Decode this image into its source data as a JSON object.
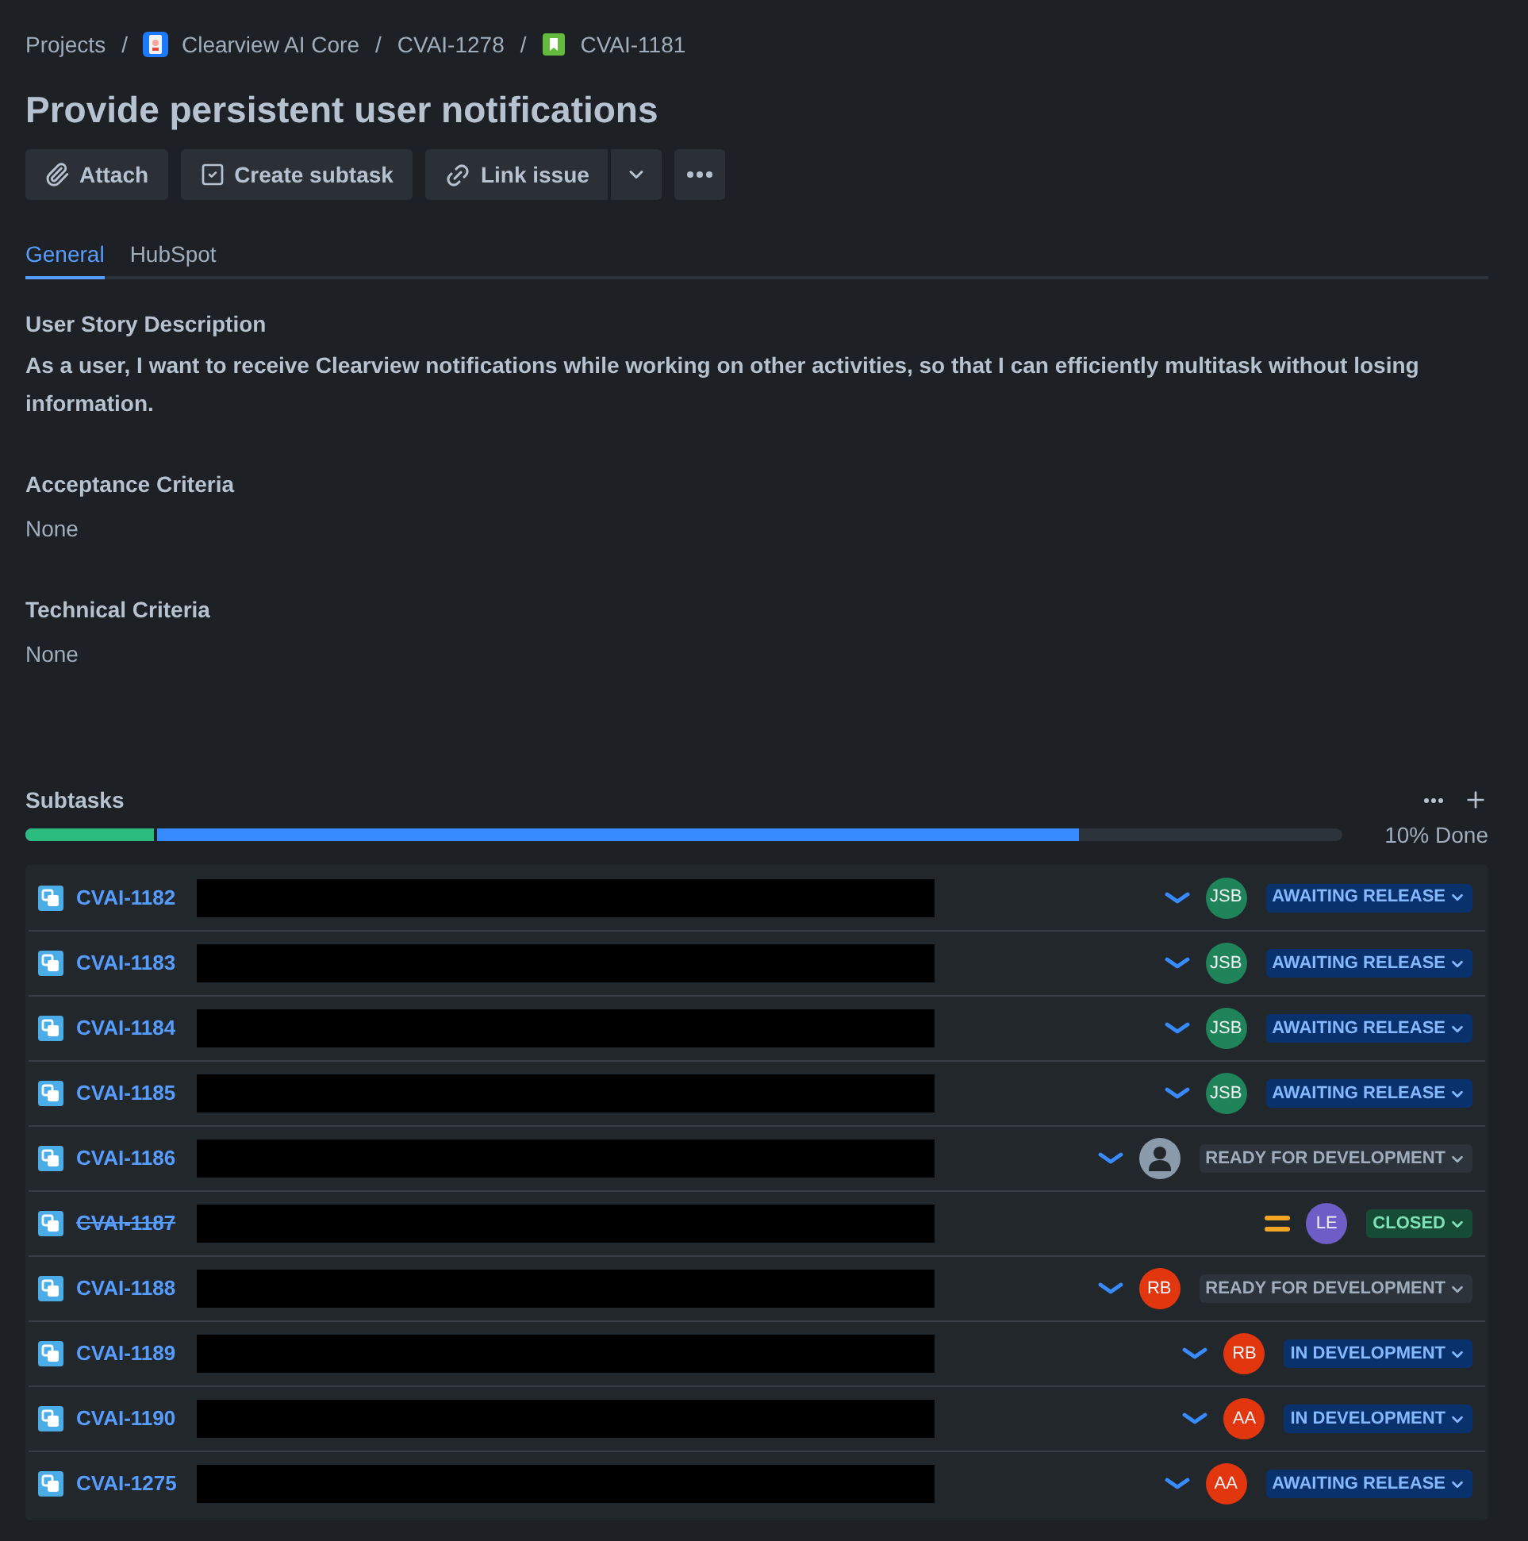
{
  "breadcrumbs": {
    "separator": "/",
    "items": [
      {
        "label": "Projects",
        "kind": "text"
      },
      {
        "label": "Clearview AI Core",
        "kind": "project"
      },
      {
        "label": "CVAI-1278",
        "kind": "text"
      },
      {
        "label": "CVAI-1181",
        "kind": "story"
      }
    ]
  },
  "title": "Provide persistent user notifications",
  "toolbar": [
    {
      "kind": "attach",
      "label": "Attach"
    },
    {
      "kind": "subtask",
      "label": "Create subtask"
    },
    {
      "kind": "link",
      "label": "Link issue"
    },
    {
      "kind": "more"
    }
  ],
  "tabs": [
    {
      "label": "General",
      "selected": true
    },
    {
      "label": "HubSpot",
      "selected": false
    }
  ],
  "sections": [
    {
      "heading": "User Story Description",
      "body": "As a user, I want to receive Clearview notifications while working on other activities, so that I can efficiently multitask without losing information.",
      "empty": false
    },
    {
      "heading": "Acceptance Criteria",
      "body": "None",
      "empty": true
    },
    {
      "heading": "Technical Criteria",
      "body": "None",
      "empty": true
    }
  ],
  "subtasks": {
    "title": "Subtasks",
    "progress": {
      "segments": [
        {
          "kind": "done",
          "level": 0.1
        },
        {
          "kind": "in_progress",
          "level": 0.8
        }
      ],
      "reading": "10% Done"
    },
    "rows": [
      {
        "key": "CVAI-1182",
        "resolved": false,
        "redacted": true,
        "priority": {
          "kind": "low"
        },
        "assignee": {
          "kind": "initials",
          "initials": "JSB",
          "color": "#1f845a"
        },
        "status": {
          "label": "AWAITING RELEASE",
          "kind": "in_progress"
        }
      },
      {
        "key": "CVAI-1183",
        "resolved": false,
        "redacted": true,
        "priority": {
          "kind": "low"
        },
        "assignee": {
          "kind": "initials",
          "initials": "JSB",
          "color": "#1f845a"
        },
        "status": {
          "label": "AWAITING RELEASE",
          "kind": "in_progress"
        }
      },
      {
        "key": "CVAI-1184",
        "resolved": false,
        "redacted": true,
        "priority": {
          "kind": "low"
        },
        "assignee": {
          "kind": "initials",
          "initials": "JSB",
          "color": "#1f845a"
        },
        "status": {
          "label": "AWAITING RELEASE",
          "kind": "in_progress"
        }
      },
      {
        "key": "CVAI-1185",
        "resolved": false,
        "redacted": true,
        "priority": {
          "kind": "low"
        },
        "assignee": {
          "kind": "initials",
          "initials": "JSB",
          "color": "#1f845a"
        },
        "status": {
          "label": "AWAITING RELEASE",
          "kind": "in_progress"
        }
      },
      {
        "key": "CVAI-1186",
        "resolved": false,
        "redacted": true,
        "priority": {
          "kind": "low"
        },
        "assignee": {
          "kind": "unassigned"
        },
        "status": {
          "label": "READY FOR DEVELOPMENT",
          "kind": "todo"
        }
      },
      {
        "key": "CVAI-1187",
        "resolved": true,
        "redacted": true,
        "priority": {
          "kind": "medium"
        },
        "assignee": {
          "kind": "initials",
          "initials": "LE",
          "color": "#6e5dc6"
        },
        "status": {
          "label": "CLOSED",
          "kind": "done"
        }
      },
      {
        "key": "CVAI-1188",
        "resolved": false,
        "redacted": true,
        "priority": {
          "kind": "low"
        },
        "assignee": {
          "kind": "initials",
          "initials": "RB",
          "color": "#e2360f"
        },
        "status": {
          "label": "READY FOR DEVELOPMENT",
          "kind": "todo"
        }
      },
      {
        "key": "CVAI-1189",
        "resolved": false,
        "redacted": true,
        "priority": {
          "kind": "low"
        },
        "assignee": {
          "kind": "initials",
          "initials": "RB",
          "color": "#e2360f"
        },
        "status": {
          "label": "IN DEVELOPMENT",
          "kind": "in_progress"
        }
      },
      {
        "key": "CVAI-1190",
        "resolved": false,
        "redacted": true,
        "priority": {
          "kind": "low"
        },
        "assignee": {
          "kind": "initials",
          "initials": "AA",
          "color": "#e2360f"
        },
        "status": {
          "label": "IN DEVELOPMENT",
          "kind": "in_progress"
        }
      },
      {
        "key": "CVAI-1275",
        "resolved": false,
        "redacted": true,
        "priority": {
          "kind": "low"
        },
        "assignee": {
          "kind": "initials",
          "initials": "AA",
          "color": "#e2360f"
        },
        "status": {
          "label": "AWAITING RELEASE",
          "kind": "in_progress"
        }
      }
    ]
  }
}
